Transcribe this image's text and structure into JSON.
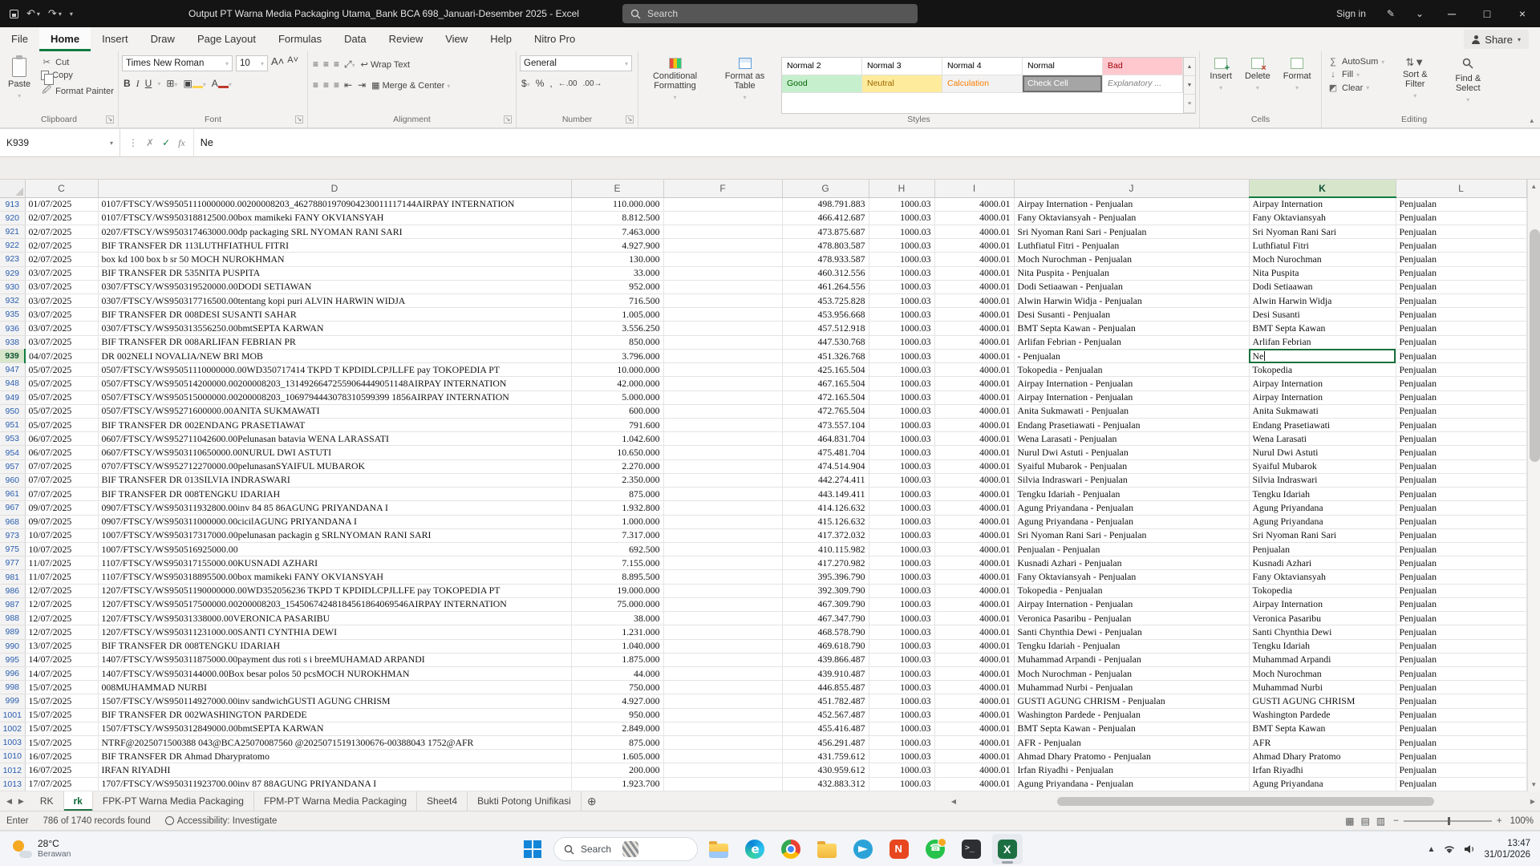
{
  "titlebar": {
    "title": "Output PT Warna Media Packaging Utama_Bank BCA 698_Januari-Desember 2025  -  Excel",
    "search_label": "Search",
    "sign_in_label": "Sign in"
  },
  "ribbon": {
    "tabs": [
      "File",
      "Home",
      "Insert",
      "Draw",
      "Page Layout",
      "Formulas",
      "Data",
      "Review",
      "View",
      "Help",
      "Nitro Pro"
    ],
    "active_tab": "Home",
    "share_label": "Share",
    "groups": {
      "clipboard": {
        "label": "Clipboard",
        "paste": "Paste",
        "cut": "Cut",
        "copy": "Copy",
        "format_painter": "Format Painter"
      },
      "font": {
        "label": "Font",
        "family": "Times New Roman",
        "size": "10"
      },
      "alignment": {
        "label": "Alignment",
        "wrap_text": "Wrap Text",
        "merge_center": "Merge & Center"
      },
      "number": {
        "label": "Number",
        "format": "General"
      },
      "styles": {
        "label": "Styles",
        "conditional_formatting": "Conditional Formatting",
        "format_as_table": "Format as Table",
        "gallery": [
          {
            "label": "Normal 2",
            "bg": "#ffffff",
            "fg": "#000000"
          },
          {
            "label": "Normal 3",
            "bg": "#ffffff",
            "fg": "#000000"
          },
          {
            "label": "Normal 4",
            "bg": "#ffffff",
            "fg": "#000000"
          },
          {
            "label": "Normal",
            "bg": "#ffffff",
            "fg": "#000000"
          },
          {
            "label": "Bad",
            "bg": "#ffc7ce",
            "fg": "#9c0006"
          },
          {
            "label": "Good",
            "bg": "#c6efce",
            "fg": "#006100"
          },
          {
            "label": "Neutral",
            "bg": "#ffeb9c",
            "fg": "#9c6500"
          },
          {
            "label": "Calculation",
            "bg": "#f2f2f2",
            "fg": "#fa7d00"
          },
          {
            "label": "Check Cell",
            "bg": "#a5a5a5",
            "fg": "#ffffff"
          },
          {
            "label": "Explanatory ...",
            "bg": "#ffffff",
            "fg": "#7f7f7f"
          }
        ]
      },
      "cells": {
        "label": "Cells",
        "insert": "Insert",
        "delete": "Delete",
        "format": "Format"
      },
      "editing": {
        "label": "Editing",
        "autosum": "AutoSum",
        "fill": "Fill",
        "clear": "Clear",
        "sort_filter": "Sort & Filter",
        "find_select": "Find & Select"
      }
    }
  },
  "formula_bar": {
    "name_box": "K939",
    "content": "Ne"
  },
  "grid": {
    "columns": [
      "C",
      "D",
      "E",
      "F",
      "G",
      "H",
      "I",
      "J",
      "K",
      "L"
    ],
    "selected_column": "K",
    "selected_row": "939",
    "rows": [
      {
        "n": "913",
        "c": "01/07/2025",
        "d": "0107/FTSCY/WS95051110000000.00200008203_46278801970904230011117144AIRPAY INTERNATION",
        "e": "110.000.000",
        "g": "498.791.883",
        "h": "1000.03",
        "i": "4000.01",
        "j": "Airpay Internation - Penjualan",
        "k": "Airpay Internation",
        "l": "Penjualan"
      },
      {
        "n": "920",
        "c": "02/07/2025",
        "d": "0107/FTSCY/WS950318812500.00box mamikeki FANY OKVIANSYAH",
        "e": "8.812.500",
        "g": "466.412.687",
        "h": "1000.03",
        "i": "4000.01",
        "j": "Fany Oktaviansyah - Penjualan",
        "k": "Fany Oktaviansyah",
        "l": "Penjualan"
      },
      {
        "n": "921",
        "c": "02/07/2025",
        "d": "0207/FTSCY/WS950317463000.00dp packaging SRL NYOMAN RANI SARI",
        "e": "7.463.000",
        "g": "473.875.687",
        "h": "1000.03",
        "i": "4000.01",
        "j": "Sri Nyoman Rani Sari - Penjualan",
        "k": "Sri Nyoman Rani Sari",
        "l": "Penjualan"
      },
      {
        "n": "922",
        "c": "02/07/2025",
        "d": "BIF TRANSFER DR 113LUTHFIATHUL FITRI",
        "e": "4.927.900",
        "g": "478.803.587",
        "h": "1000.03",
        "i": "4000.01",
        "j": "Luthfiatul Fitri - Penjualan",
        "k": "Luthfiatul Fitri",
        "l": "Penjualan"
      },
      {
        "n": "923",
        "c": "02/07/2025",
        "d": "box kd 100 box b sr 50 MOCH NUROKHMAN",
        "e": "130.000",
        "g": "478.933.587",
        "h": "1000.03",
        "i": "4000.01",
        "j": "Moch Nurochman - Penjualan",
        "k": "Moch Nurochman",
        "l": "Penjualan"
      },
      {
        "n": "929",
        "c": "03/07/2025",
        "d": "BIF TRANSFER DR 535NITA PUSPITA",
        "e": "33.000",
        "g": "460.312.556",
        "h": "1000.03",
        "i": "4000.01",
        "j": "Nita Puspita - Penjualan",
        "k": "Nita Puspita",
        "l": "Penjualan"
      },
      {
        "n": "930",
        "c": "03/07/2025",
        "d": "0307/FTSCY/WS950319520000.00DODI SETIAWAN",
        "e": "952.000",
        "g": "461.264.556",
        "h": "1000.03",
        "i": "4000.01",
        "j": "Dodi Setiaawan - Penjualan",
        "k": "Dodi Setiaawan",
        "l": "Penjualan"
      },
      {
        "n": "932",
        "c": "03/07/2025",
        "d": "0307/FTSCY/WS950317716500.00tentang kopi puri ALVIN HARWIN WIDJA",
        "e": "716.500",
        "g": "453.725.828",
        "h": "1000.03",
        "i": "4000.01",
        "j": "Alwin Harwin Widja - Penjualan",
        "k": "Alwin Harwin Widja",
        "l": "Penjualan"
      },
      {
        "n": "935",
        "c": "03/07/2025",
        "d": "BIF TRANSFER DR 008DESI SUSANTI SAHAR",
        "e": "1.005.000",
        "g": "453.956.668",
        "h": "1000.03",
        "i": "4000.01",
        "j": "Desi Susanti - Penjualan",
        "k": "Desi Susanti",
        "l": "Penjualan"
      },
      {
        "n": "936",
        "c": "03/07/2025",
        "d": "0307/FTSCY/WS950313556250.00bmtSEPTA KARWAN",
        "e": "3.556.250",
        "g": "457.512.918",
        "h": "1000.03",
        "i": "4000.01",
        "j": "BMT Septa Kawan - Penjualan",
        "k": "BMT Septa Kawan",
        "l": "Penjualan"
      },
      {
        "n": "938",
        "c": "03/07/2025",
        "d": "BIF TRANSFER DR 008ARLIFAN FEBRIAN PR",
        "e": "850.000",
        "g": "447.530.768",
        "h": "1000.03",
        "i": "4000.01",
        "j": "Arlifan Febrian - Penjualan",
        "k": "Arlifan Febrian",
        "l": "Penjualan"
      },
      {
        "n": "939",
        "c": "04/07/2025",
        "d": "DR 002NELI NOVALIA/NEW BRI MOB",
        "e": "3.796.000",
        "g": "451.326.768",
        "h": "1000.03",
        "i": "4000.01",
        "j": "- Penjualan",
        "k": "Ne",
        "l": "Penjualan",
        "active": true
      },
      {
        "n": "947",
        "c": "05/07/2025",
        "d": "0507/FTSCY/WS95051110000000.00WD350717414 TKPD T KPDIDLCPJLLFE pay TOKOPEDIA PT",
        "e": "10.000.000",
        "g": "425.165.504",
        "h": "1000.03",
        "i": "4000.01",
        "j": "Tokopedia - Penjualan",
        "k": "Tokopedia",
        "l": "Penjualan"
      },
      {
        "n": "948",
        "c": "05/07/2025",
        "d": "0507/FTSCY/WS950514200000.00200008203_13149266472559064449051148AIRPAY INTERNATION",
        "e": "42.000.000",
        "g": "467.165.504",
        "h": "1000.03",
        "i": "4000.01",
        "j": "Airpay Internation - Penjualan",
        "k": "Airpay Internation",
        "l": "Penjualan"
      },
      {
        "n": "949",
        "c": "05/07/2025",
        "d": "0507/FTSCY/WS950515000000.00200008203_1069794443078310599399 1856AIRPAY INTERNATION",
        "e": "5.000.000",
        "g": "472.165.504",
        "h": "1000.03",
        "i": "4000.01",
        "j": "Airpay Internation - Penjualan",
        "k": "Airpay Internation",
        "l": "Penjualan"
      },
      {
        "n": "950",
        "c": "05/07/2025",
        "d": "0507/FTSCY/WS95271600000.00ANITA SUKMAWATI",
        "e": "600.000",
        "g": "472.765.504",
        "h": "1000.03",
        "i": "4000.01",
        "j": "Anita Sukmawati - Penjualan",
        "k": "Anita Sukmawati",
        "l": "Penjualan"
      },
      {
        "n": "951",
        "c": "05/07/2025",
        "d": "BIF TRANSFER DR 002ENDANG PRASETIAWAT",
        "e": "791.600",
        "g": "473.557.104",
        "h": "1000.03",
        "i": "4000.01",
        "j": "Endang Prasetiawati - Penjualan",
        "k": "Endang Prasetiawati",
        "l": "Penjualan"
      },
      {
        "n": "953",
        "c": "06/07/2025",
        "d": "0607/FTSCY/WS952711042600.00Pelunasan batavia WENA LARASSATI",
        "e": "1.042.600",
        "g": "464.831.704",
        "h": "1000.03",
        "i": "4000.01",
        "j": "Wena Larasati - Penjualan",
        "k": "Wena Larasati",
        "l": "Penjualan"
      },
      {
        "n": "954",
        "c": "06/07/2025",
        "d": "0607/FTSCY/WS9503110650000.00NURUL DWI ASTUTI",
        "e": "10.650.000",
        "g": "475.481.704",
        "h": "1000.03",
        "i": "4000.01",
        "j": "Nurul Dwi Astuti - Penjualan",
        "k": "Nurul Dwi Astuti",
        "l": "Penjualan"
      },
      {
        "n": "957",
        "c": "07/07/2025",
        "d": "0707/FTSCY/WS952712270000.00pelunasanSYAIFUL MUBAROK",
        "e": "2.270.000",
        "g": "474.514.904",
        "h": "1000.03",
        "i": "4000.01",
        "j": "Syaiful Mubarok - Penjualan",
        "k": "Syaiful Mubarok",
        "l": "Penjualan"
      },
      {
        "n": "960",
        "c": "07/07/2025",
        "d": "BIF TRANSFER DR 013SILVIA INDRASWARI",
        "e": "2.350.000",
        "g": "442.274.411",
        "h": "1000.03",
        "i": "4000.01",
        "j": "Silvia Indraswari - Penjualan",
        "k": "Silvia Indraswari",
        "l": "Penjualan"
      },
      {
        "n": "961",
        "c": "07/07/2025",
        "d": "BIF TRANSFER DR 008TENGKU IDARIAH",
        "e": "875.000",
        "g": "443.149.411",
        "h": "1000.03",
        "i": "4000.01",
        "j": "Tengku Idariah - Penjualan",
        "k": "Tengku Idariah",
        "l": "Penjualan"
      },
      {
        "n": "967",
        "c": "09/07/2025",
        "d": "0907/FTSCY/WS950311932800.00inv 84 85 86AGUNG PRIYANDANA I",
        "e": "1.932.800",
        "g": "414.126.632",
        "h": "1000.03",
        "i": "4000.01",
        "j": "Agung Priyandana - Penjualan",
        "k": "Agung Priyandana",
        "l": "Penjualan"
      },
      {
        "n": "968",
        "c": "09/07/2025",
        "d": "0907/FTSCY/WS950311000000.00cicilAGUNG PRIYANDANA I",
        "e": "1.000.000",
        "g": "415.126.632",
        "h": "1000.03",
        "i": "4000.01",
        "j": "Agung Priyandana - Penjualan",
        "k": "Agung Priyandana",
        "l": "Penjualan"
      },
      {
        "n": "973",
        "c": "10/07/2025",
        "d": "1007/FTSCY/WS950317317000.00pelunasan packagin g SRLNYOMAN RANI SARI",
        "e": "7.317.000",
        "g": "417.372.032",
        "h": "1000.03",
        "i": "4000.01",
        "j": "Sri Nyoman Rani Sari - Penjualan",
        "k": "Sri Nyoman Rani Sari",
        "l": "Penjualan"
      },
      {
        "n": "975",
        "c": "10/07/2025",
        "d": "1007/FTSCY/WS950516925000.00",
        "e": "692.500",
        "g": "410.115.982",
        "h": "1000.03",
        "i": "4000.01",
        "j": "Penjualan - Penjualan",
        "k": "Penjualan",
        "l": "Penjualan"
      },
      {
        "n": "977",
        "c": "11/07/2025",
        "d": "1107/FTSCY/WS950317155000.00KUSNADI AZHARI",
        "e": "7.155.000",
        "g": "417.270.982",
        "h": "1000.03",
        "i": "4000.01",
        "j": "Kusnadi Azhari - Penjualan",
        "k": "Kusnadi Azhari",
        "l": "Penjualan"
      },
      {
        "n": "981",
        "c": "11/07/2025",
        "d": "1107/FTSCY/WS950318895500.00box mamikeki FANY OKVIANSYAH",
        "e": "8.895.500",
        "g": "395.396.790",
        "h": "1000.03",
        "i": "4000.01",
        "j": "Fany Oktaviansyah - Penjualan",
        "k": "Fany Oktaviansyah",
        "l": "Penjualan"
      },
      {
        "n": "986",
        "c": "12/07/2025",
        "d": "1207/FTSCY/WS95051190000000.00WD352056236 TKPD T KPDIDLCPJLLFE pay TOKOPEDIA PT",
        "e": "19.000.000",
        "g": "392.309.790",
        "h": "1000.03",
        "i": "4000.01",
        "j": "Tokopedia - Penjualan",
        "k": "Tokopedia",
        "l": "Penjualan"
      },
      {
        "n": "987",
        "c": "12/07/2025",
        "d": "1207/FTSCY/WS950517500000.00200008203_15450674248184561864069546AIRPAY INTERNATION",
        "e": "75.000.000",
        "g": "467.309.790",
        "h": "1000.03",
        "i": "4000.01",
        "j": "Airpay Internation - Penjualan",
        "k": "Airpay Internation",
        "l": "Penjualan"
      },
      {
        "n": "988",
        "c": "12/07/2025",
        "d": "1207/FTSCY/WS95031338000.00VERONICA PASARIBU",
        "e": "38.000",
        "g": "467.347.790",
        "h": "1000.03",
        "i": "4000.01",
        "j": "Veronica Pasaribu - Penjualan",
        "k": "Veronica Pasaribu",
        "l": "Penjualan"
      },
      {
        "n": "989",
        "c": "12/07/2025",
        "d": "1207/FTSCY/WS950311231000.00SANTI CYNTHIA DEWI",
        "e": "1.231.000",
        "g": "468.578.790",
        "h": "1000.03",
        "i": "4000.01",
        "j": "Santi Chynthia Dewi - Penjualan",
        "k": "Santi Chynthia Dewi",
        "l": "Penjualan"
      },
      {
        "n": "990",
        "c": "13/07/2025",
        "d": "BIF TRANSFER DR 008TENGKU IDARIAH",
        "e": "1.040.000",
        "g": "469.618.790",
        "h": "1000.03",
        "i": "4000.01",
        "j": "Tengku Idariah - Penjualan",
        "k": "Tengku Idariah",
        "l": "Penjualan"
      },
      {
        "n": "995",
        "c": "14/07/2025",
        "d": "1407/FTSCY/WS950311875000.00payment dus roti s i breeMUHAMAD ARPANDI",
        "e": "1.875.000",
        "g": "439.866.487",
        "h": "1000.03",
        "i": "4000.01",
        "j": "Muhammad Arpandi - Penjualan",
        "k": "Muhammad Arpandi",
        "l": "Penjualan"
      },
      {
        "n": "996",
        "c": "14/07/2025",
        "d": "1407/FTSCY/WS9503144000.00Box besar polos 50 pcsMOCH NUROKHMAN",
        "e": "44.000",
        "g": "439.910.487",
        "h": "1000.03",
        "i": "4000.01",
        "j": "Moch Nurochman - Penjualan",
        "k": "Moch Nurochman",
        "l": "Penjualan"
      },
      {
        "n": "998",
        "c": "15/07/2025",
        "d": "008MUHAMMAD NURBI",
        "e": "750.000",
        "g": "446.855.487",
        "h": "1000.03",
        "i": "4000.01",
        "j": "Muhammad Nurbi - Penjualan",
        "k": "Muhammad Nurbi",
        "l": "Penjualan"
      },
      {
        "n": "999",
        "c": "15/07/2025",
        "d": "1507/FTSCY/WS950114927000.00inv sandwichGUSTI AGUNG CHRISM",
        "e": "4.927.000",
        "g": "451.782.487",
        "h": "1000.03",
        "i": "4000.01",
        "j": "GUSTI AGUNG CHRISM - Penjualan",
        "k": "GUSTI AGUNG CHRISM",
        "l": "Penjualan"
      },
      {
        "n": "1001",
        "c": "15/07/2025",
        "d": "BIF TRANSFER DR 002WASHINGTON PARDEDE",
        "e": "950.000",
        "g": "452.567.487",
        "h": "1000.03",
        "i": "4000.01",
        "j": "Washington Pardede - Penjualan",
        "k": "Washington Pardede",
        "l": "Penjualan"
      },
      {
        "n": "1002",
        "c": "15/07/2025",
        "d": "1507/FTSCY/WS950312849000.00bmtSEPTA KARWAN",
        "e": "2.849.000",
        "g": "455.416.487",
        "h": "1000.03",
        "i": "4000.01",
        "j": "BMT Septa Kawan - Penjualan",
        "k": "BMT Septa Kawan",
        "l": "Penjualan"
      },
      {
        "n": "1003",
        "c": "15/07/2025",
        "d": "NTRF@2025071500388 043@BCA25070087560 @20250715191300676-00388043 1752@AFR",
        "e": "875.000",
        "g": "456.291.487",
        "h": "1000.03",
        "i": "4000.01",
        "j": "AFR - Penjualan",
        "k": "AFR",
        "l": "Penjualan"
      },
      {
        "n": "1010",
        "c": "16/07/2025",
        "d": "BIF TRANSFER DR Ahmad Dharypratomo",
        "e": "1.605.000",
        "g": "431.759.612",
        "h": "1000.03",
        "i": "4000.01",
        "j": "Ahmad Dhary Pratomo - Penjualan",
        "k": "Ahmad Dhary Pratomo",
        "l": "Penjualan"
      },
      {
        "n": "1012",
        "c": "16/07/2025",
        "d": "IRFAN RIYADHI",
        "e": "200.000",
        "g": "430.959.612",
        "h": "1000.03",
        "i": "4000.01",
        "j": "Irfan Riyadhi - Penjualan",
        "k": "Irfan Riyadhi",
        "l": "Penjualan"
      },
      {
        "n": "1013",
        "c": "17/07/2025",
        "d": "1707/FTSCY/WS950311923700.00inv 87 88AGUNG PRIYANDANA I",
        "e": "1.923.700",
        "g": "432.883.312",
        "h": "1000.03",
        "i": "4000.01",
        "j": "Agung Priyandana - Penjualan",
        "k": "Agung Priyandana",
        "l": "Penjualan"
      }
    ]
  },
  "sheet_bar": {
    "tabs": [
      "RK",
      "rk",
      "FPK-PT Warna Media Packaging",
      "FPM-PT Warna Media Packaging",
      "Sheet4",
      "Bukti Potong Unifikasi"
    ],
    "active_tab": "rk"
  },
  "status_bar": {
    "mode": "Enter",
    "records": "786 of 1740 records found",
    "accessibility": "Accessibility: Investigate",
    "zoom": "100%"
  },
  "taskbar": {
    "weather": {
      "temp": "28°C",
      "desc": "Berawan"
    },
    "search_label": "Search",
    "icons": [
      "file-explorer",
      "edge",
      "chrome",
      "folder",
      "telegram",
      "nitro-pdf",
      "whatsapp",
      "terminal",
      "excel"
    ],
    "active_icon": "excel",
    "tray": {
      "time": "13:47",
      "date": "31/01/2026"
    }
  },
  "colors": {
    "excel_green": "#107c41",
    "selection_border": "#17713d",
    "filtered_row_number": "#2a5db0"
  }
}
